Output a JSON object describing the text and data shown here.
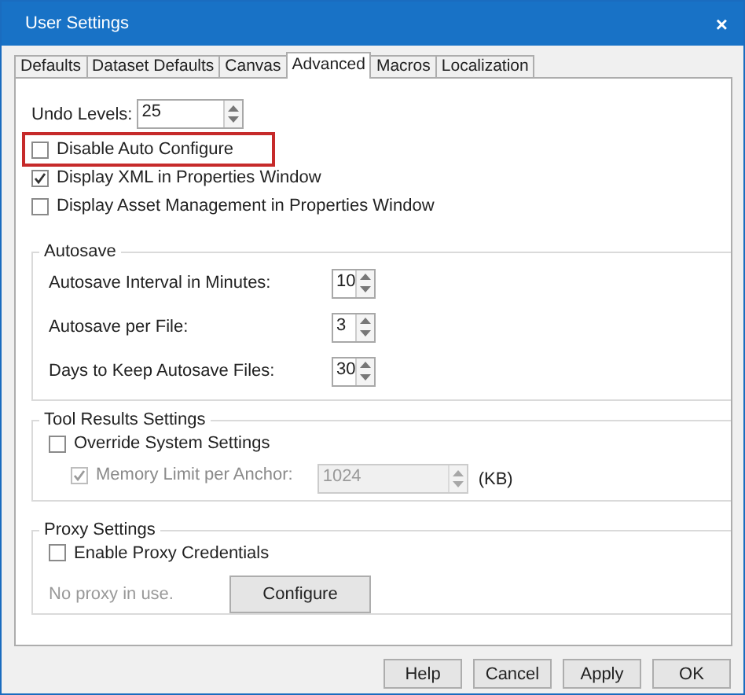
{
  "window": {
    "title": "User Settings",
    "close": "×"
  },
  "tabs": [
    {
      "label": "Defaults",
      "selected": false
    },
    {
      "label": "Dataset Defaults",
      "selected": false
    },
    {
      "label": "Canvas",
      "selected": false
    },
    {
      "label": "Advanced",
      "selected": true
    },
    {
      "label": "Macros",
      "selected": false
    },
    {
      "label": "Localization",
      "selected": false
    }
  ],
  "undo_levels": {
    "label": "Undo Levels:",
    "value": "25"
  },
  "options": [
    {
      "label": "Disable Auto Configure",
      "checked": false,
      "highlighted": true
    },
    {
      "label": "Display XML in Properties Window",
      "checked": true,
      "highlighted": false
    },
    {
      "label": "Display Asset Management in Properties Window",
      "checked": false,
      "highlighted": false
    }
  ],
  "autosave": {
    "title": "Autosave",
    "rows": [
      {
        "label": "Autosave Interval in Minutes:",
        "value": "10"
      },
      {
        "label": "Autosave per File:",
        "value": "3"
      },
      {
        "label": "Days to Keep Autosave Files:",
        "value": "30"
      }
    ]
  },
  "tool_results": {
    "title": "Tool Results Settings",
    "override": {
      "label": "Override System Settings",
      "checked": false
    },
    "memory": {
      "label": "Memory Limit per Anchor:",
      "checked": true,
      "disabled": true,
      "value": "1024",
      "unit": "(KB)"
    }
  },
  "proxy": {
    "title": "Proxy Settings",
    "enable": {
      "label": "Enable Proxy Credentials",
      "checked": false
    },
    "status": "No proxy in use.",
    "button": "Configure"
  },
  "buttons": [
    "Help",
    "Cancel",
    "Apply",
    "OK"
  ]
}
